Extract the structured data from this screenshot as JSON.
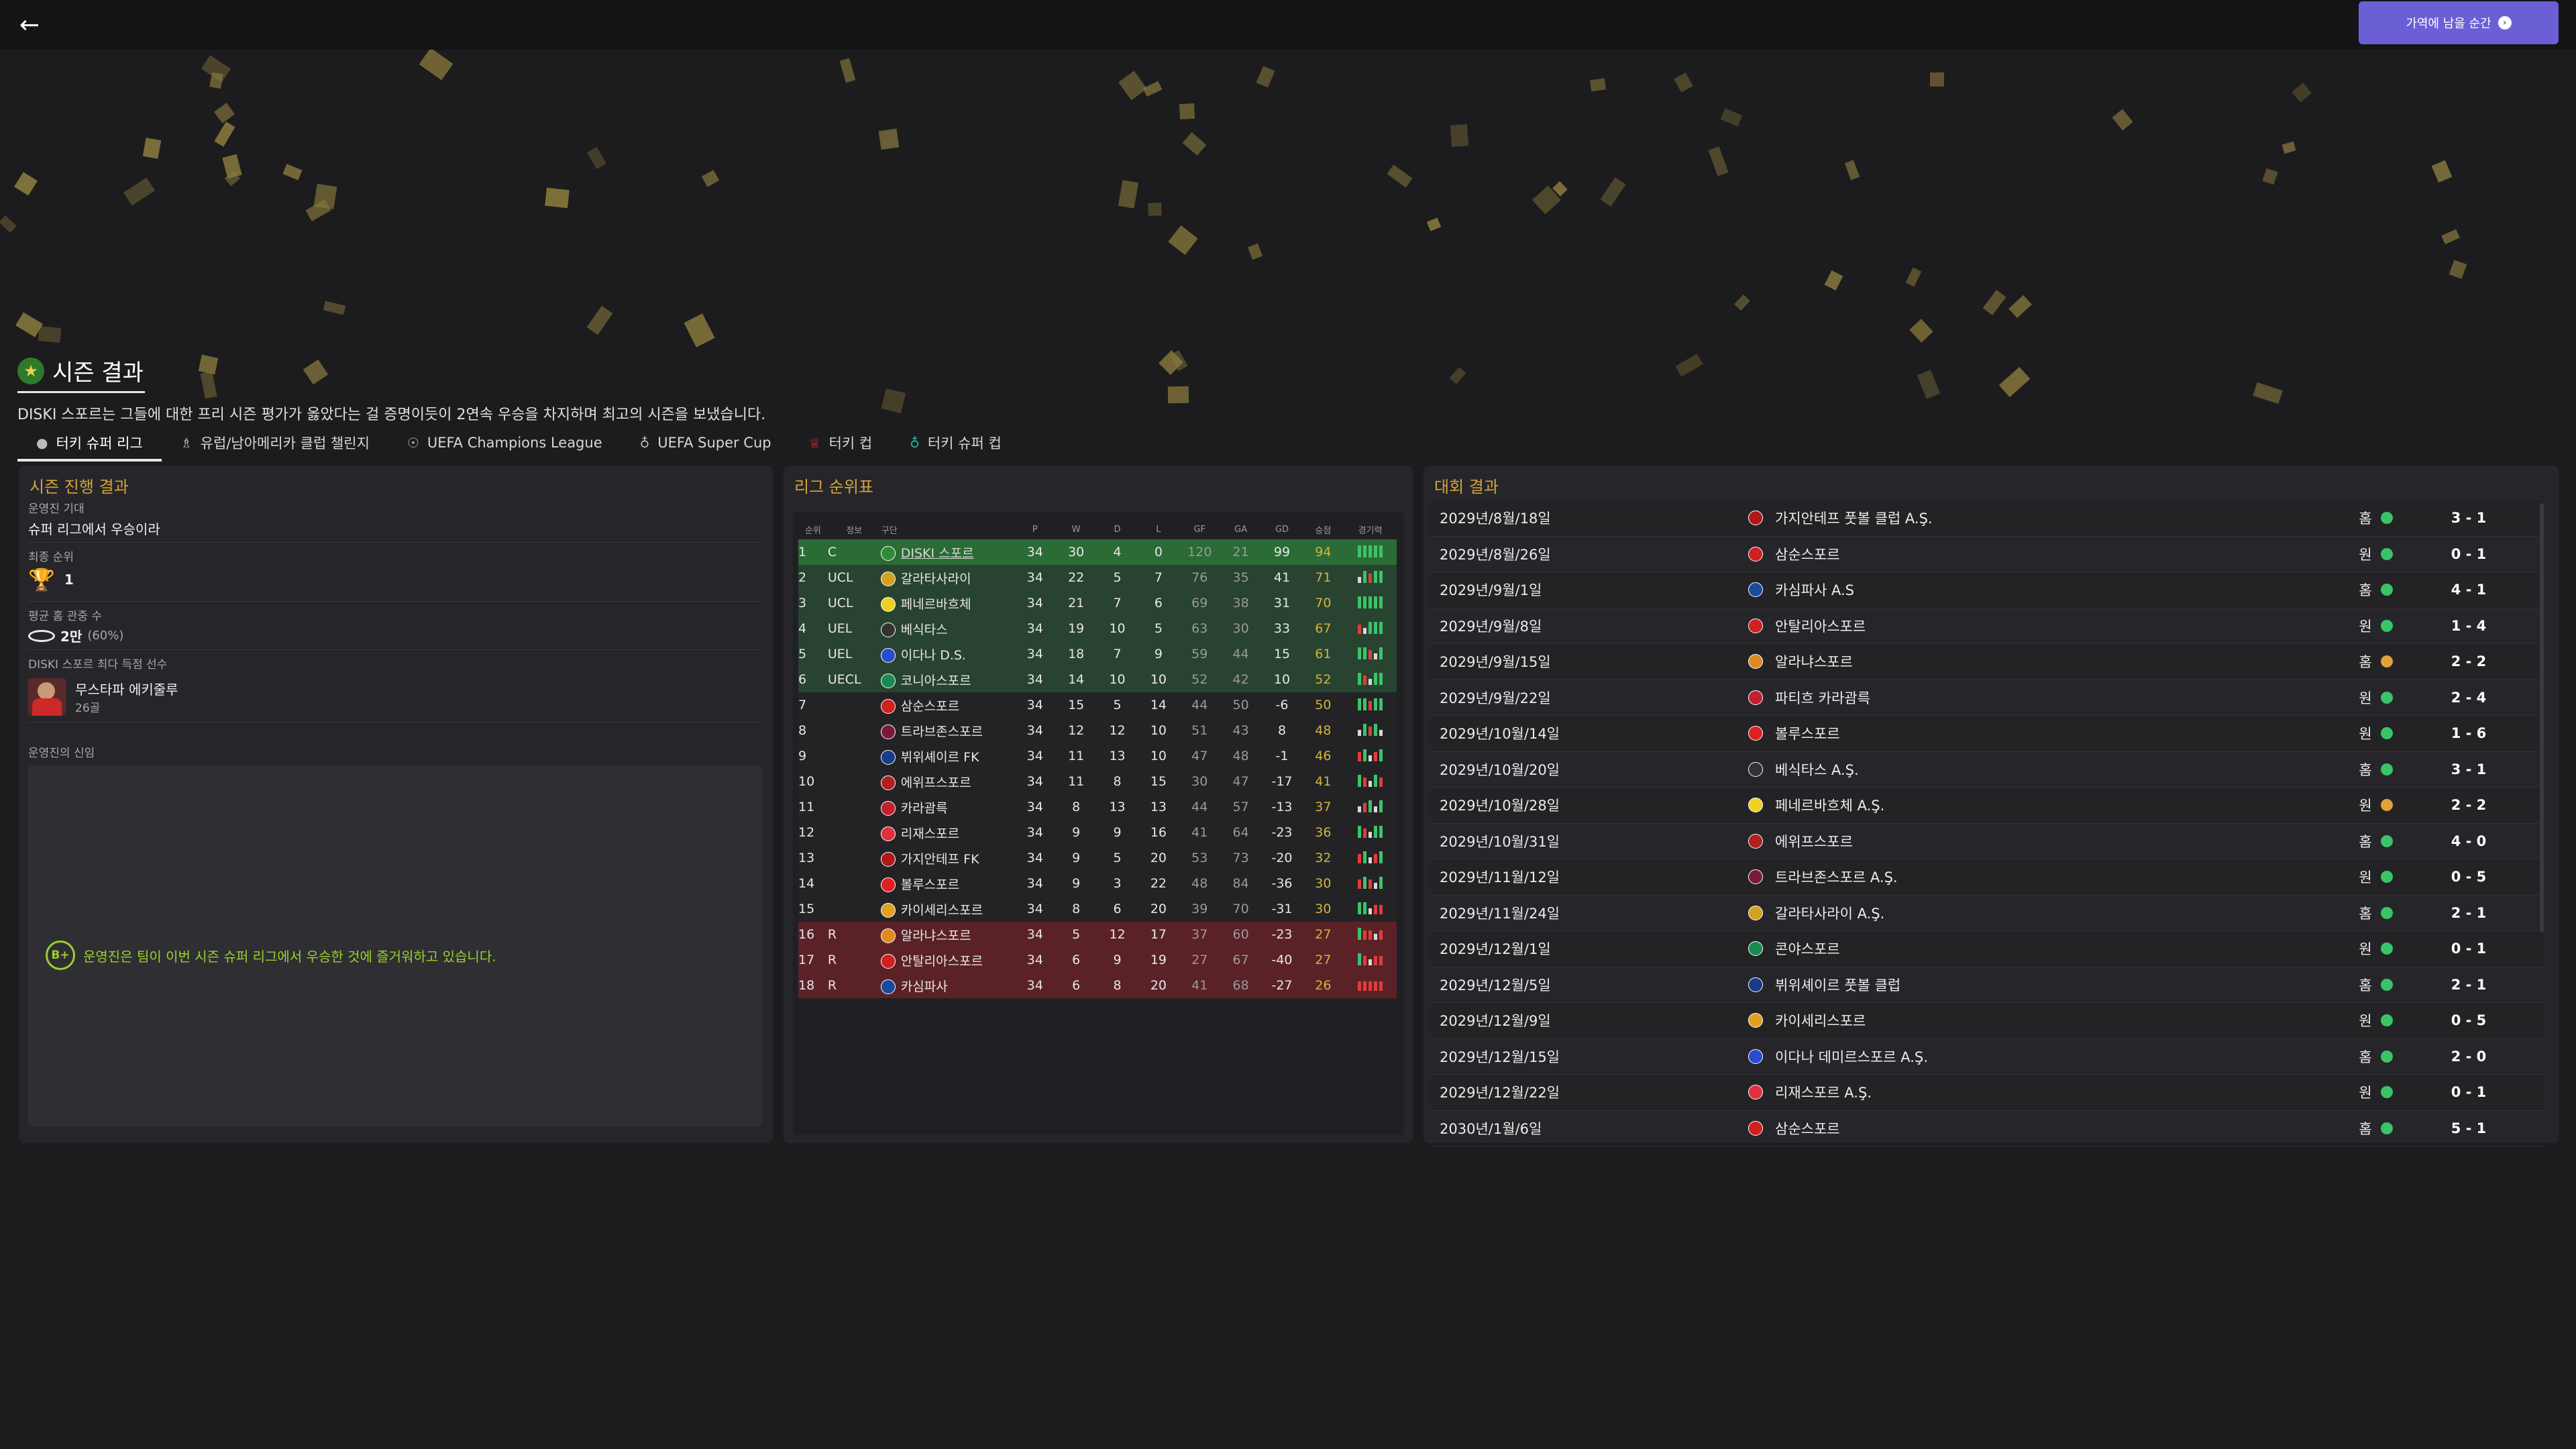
{
  "topbar": {
    "back_icon": "back-arrow-icon",
    "continue_label": "가역에 남을 순간",
    "continue_icon": "chevron-right-icon",
    "accent": "#6b5fd6"
  },
  "header": {
    "title": "시즌 결과",
    "summary": "DISKI 스포르는 그들에 대한 프리 시즌 평가가 옳았다는 걸 증명이듯이 2연속 우승을 차지하며 최고의 시즌을 보냈습니다."
  },
  "tabs": [
    {
      "label": "터키 슈퍼 리그",
      "icon": "league-ball-icon"
    },
    {
      "label": "유럽/남아메리카 클럽 챌린지",
      "icon": "trophy-icon"
    },
    {
      "label": "UEFA Champions League",
      "icon": "champions-league-icon"
    },
    {
      "label": "UEFA Super Cup",
      "icon": "super-cup-icon"
    },
    {
      "label": "터키 컵",
      "icon": "turkish-cup-icon"
    },
    {
      "label": "터키 슈퍼 컵",
      "icon": "super-cup-icon"
    }
  ],
  "season": {
    "title": "시즌 진행 결과",
    "expectation_label": "운영진 기대",
    "expectation_value": "슈퍼 리그에서 우승이라",
    "final_pos_label": "최종 순위",
    "final_pos_value": "1",
    "attendance_label": "평균 홈 관중 수",
    "attendance_value": "2만",
    "attendance_pct": "(60%)",
    "top_scorer_label": "DISKI 스포르 최다 득점 선수",
    "top_scorer_name": "무스타파 에키줄루",
    "top_scorer_goals": "26골",
    "board_label": "운영진의 신임",
    "grade": "B+",
    "board_comment": "운영진은 팀이 이번 시즌 슈퍼 리그에서 우승한 것에 즐거워하고 있습니다."
  },
  "standings": {
    "title": "리그 순위표",
    "headers": [
      "순위",
      "정보",
      "구단",
      "P",
      "W",
      "D",
      "L",
      "GF",
      "GA",
      "GD",
      "승점",
      "경기력"
    ],
    "rows": [
      {
        "pos": "1",
        "info": "C",
        "team": "DISKI 스포르",
        "p": "34",
        "w": "30",
        "d": "4",
        "l": "0",
        "gf": "120",
        "ga": "21",
        "gd": "99",
        "pts": "94",
        "zone": "champ",
        "color": "#2e8b3a",
        "form": "WWWWW"
      },
      {
        "pos": "2",
        "info": "UCL",
        "team": "갈라타사라이",
        "p": "34",
        "w": "22",
        "d": "5",
        "l": "7",
        "gf": "76",
        "ga": "35",
        "gd": "41",
        "pts": "71",
        "zone": "euro",
        "color": "#d4a020",
        "form": "DWLWW"
      },
      {
        "pos": "3",
        "info": "UCL",
        "team": "페네르바흐체",
        "p": "34",
        "w": "21",
        "d": "7",
        "l": "6",
        "gf": "69",
        "ga": "38",
        "gd": "31",
        "pts": "70",
        "zone": "euro",
        "color": "#f0d020",
        "form": "WWWWW"
      },
      {
        "pos": "4",
        "info": "UEL",
        "team": "베식타스",
        "p": "34",
        "w": "19",
        "d": "10",
        "l": "5",
        "gf": "63",
        "ga": "30",
        "gd": "33",
        "pts": "67",
        "zone": "euro",
        "color": "#333333",
        "form": "LDWWW"
      },
      {
        "pos": "5",
        "info": "UEL",
        "team": "이다나 D.S.",
        "p": "34",
        "w": "18",
        "d": "7",
        "l": "9",
        "gf": "59",
        "ga": "44",
        "gd": "15",
        "pts": "61",
        "zone": "euro",
        "color": "#2a4ad0",
        "form": "WWLDW"
      },
      {
        "pos": "6",
        "info": "UECL",
        "team": "코니아스포르",
        "p": "34",
        "w": "14",
        "d": "10",
        "l": "10",
        "gf": "52",
        "ga": "42",
        "gd": "10",
        "pts": "52",
        "zone": "euro",
        "color": "#1a8a50",
        "form": "WLDWW"
      },
      {
        "pos": "7",
        "info": "",
        "team": "삼순스포르",
        "p": "34",
        "w": "15",
        "d": "5",
        "l": "14",
        "gf": "44",
        "ga": "50",
        "gd": "-6",
        "pts": "50",
        "zone": "mid",
        "color": "#d02020",
        "form": "WWLWW"
      },
      {
        "pos": "8",
        "info": "",
        "team": "트라브존스포르",
        "p": "34",
        "w": "12",
        "d": "12",
        "l": "10",
        "gf": "51",
        "ga": "43",
        "gd": "8",
        "pts": "48",
        "zone": "mid",
        "color": "#7a1a3a",
        "form": "DWLWD"
      },
      {
        "pos": "9",
        "info": "",
        "team": "뷔위셰이르 FK",
        "p": "34",
        "w": "11",
        "d": "13",
        "l": "10",
        "gf": "47",
        "ga": "48",
        "gd": "-1",
        "pts": "46",
        "zone": "mid",
        "color": "#1a3a8a",
        "form": "LWDLW"
      },
      {
        "pos": "10",
        "info": "",
        "team": "에위프스포르",
        "p": "34",
        "w": "11",
        "d": "8",
        "l": "15",
        "gf": "30",
        "ga": "47",
        "gd": "-17",
        "pts": "41",
        "zone": "mid",
        "color": "#b02020",
        "form": "WLDWL"
      },
      {
        "pos": "11",
        "info": "",
        "team": "카라괌륵",
        "p": "34",
        "w": "8",
        "d": "13",
        "l": "13",
        "gf": "44",
        "ga": "57",
        "gd": "-13",
        "pts": "37",
        "zone": "mid",
        "color": "#c02030",
        "form": "DLWDW"
      },
      {
        "pos": "12",
        "info": "",
        "team": "리재스포르",
        "p": "34",
        "w": "9",
        "d": "9",
        "l": "16",
        "gf": "41",
        "ga": "64",
        "gd": "-23",
        "pts": "36",
        "zone": "mid",
        "color": "#e03040",
        "form": "WLDWW"
      },
      {
        "pos": "13",
        "info": "",
        "team": "가지안테프 FK",
        "p": "34",
        "w": "9",
        "d": "5",
        "l": "20",
        "gf": "53",
        "ga": "73",
        "gd": "-20",
        "pts": "32",
        "zone": "mid",
        "color": "#b01818",
        "form": "LWDLW"
      },
      {
        "pos": "14",
        "info": "",
        "team": "볼루스포르",
        "p": "34",
        "w": "9",
        "d": "3",
        "l": "22",
        "gf": "48",
        "ga": "84",
        "gd": "-36",
        "pts": "30",
        "zone": "mid",
        "color": "#e02020",
        "form": "LWLDW"
      },
      {
        "pos": "15",
        "info": "",
        "team": "카이세리스포르",
        "p": "34",
        "w": "8",
        "d": "6",
        "l": "20",
        "gf": "39",
        "ga": "70",
        "gd": "-31",
        "pts": "30",
        "zone": "mid",
        "color": "#e0a020",
        "form": "WWDLL"
      },
      {
        "pos": "16",
        "info": "R",
        "team": "알라냐스포르",
        "p": "34",
        "w": "5",
        "d": "12",
        "l": "17",
        "gf": "37",
        "ga": "60",
        "gd": "-23",
        "pts": "27",
        "zone": "rel",
        "color": "#e08a20",
        "form": "WLLDL"
      },
      {
        "pos": "17",
        "info": "R",
        "team": "안탈리아스포르",
        "p": "34",
        "w": "6",
        "d": "9",
        "l": "19",
        "gf": "27",
        "ga": "67",
        "gd": "-40",
        "pts": "27",
        "zone": "rel",
        "color": "#d02020",
        "form": "WLDLL"
      },
      {
        "pos": "18",
        "info": "R",
        "team": "카심파사",
        "p": "34",
        "w": "6",
        "d": "8",
        "l": "20",
        "gf": "41",
        "ga": "68",
        "gd": "-27",
        "pts": "26",
        "zone": "rel",
        "color": "#1a4aa0",
        "form": "LLLLL"
      }
    ]
  },
  "results": {
    "title": "대회 결과",
    "rows": [
      {
        "date": "2029년/8월/18일",
        "team": "가지안테프 풋볼 클럽 A.Ş.",
        "ha": "홈",
        "outcome": "win",
        "score": "3 - 1",
        "color": "#b01818"
      },
      {
        "date": "2029년/8월/26일",
        "team": "삼순스포르",
        "ha": "원",
        "outcome": "win",
        "score": "0 - 1",
        "color": "#d02020"
      },
      {
        "date": "2029년/9월/1일",
        "team": "카심파사 A.S",
        "ha": "홈",
        "outcome": "win",
        "score": "4 - 1",
        "color": "#1a4aa0"
      },
      {
        "date": "2029년/9월/8일",
        "team": "안탈리아스포르",
        "ha": "원",
        "outcome": "win",
        "score": "1 - 4",
        "color": "#d02020"
      },
      {
        "date": "2029년/9월/15일",
        "team": "알라냐스포르",
        "ha": "홈",
        "outcome": "draw",
        "score": "2 - 2",
        "color": "#e08a20"
      },
      {
        "date": "2029년/9월/22일",
        "team": "파티흐 카라괌륵",
        "ha": "원",
        "outcome": "win",
        "score": "2 - 4",
        "color": "#c02030"
      },
      {
        "date": "2029년/10월/14일",
        "team": "볼루스포르",
        "ha": "원",
        "outcome": "win",
        "score": "1 - 6",
        "color": "#e02020"
      },
      {
        "date": "2029년/10월/20일",
        "team": "베식타스 A.Ş.",
        "ha": "홈",
        "outcome": "win",
        "score": "3 - 1",
        "color": "#333333"
      },
      {
        "date": "2029년/10월/28일",
        "team": "페네르바흐체 A.Ş.",
        "ha": "원",
        "outcome": "draw",
        "score": "2 - 2",
        "color": "#f0d020"
      },
      {
        "date": "2029년/10월/31일",
        "team": "에위프스포르",
        "ha": "홈",
        "outcome": "win",
        "score": "4 - 0",
        "color": "#b02020"
      },
      {
        "date": "2029년/11월/12일",
        "team": "트라브존스포르 A.Ş.",
        "ha": "원",
        "outcome": "win",
        "score": "0 - 5",
        "color": "#7a1a3a"
      },
      {
        "date": "2029년/11월/24일",
        "team": "갈라타사라이 A.Ş.",
        "ha": "홈",
        "outcome": "win",
        "score": "2 - 1",
        "color": "#d4a020"
      },
      {
        "date": "2029년/12월/1일",
        "team": "콘야스포르",
        "ha": "원",
        "outcome": "win",
        "score": "0 - 1",
        "color": "#1a8a50"
      },
      {
        "date": "2029년/12월/5일",
        "team": "뷔위셰이르 풋볼 클럽",
        "ha": "홈",
        "outcome": "win",
        "score": "2 - 1",
        "color": "#1a3a8a"
      },
      {
        "date": "2029년/12월/9일",
        "team": "카이세리스포르",
        "ha": "원",
        "outcome": "win",
        "score": "0 - 5",
        "color": "#e0a020"
      },
      {
        "date": "2029년/12월/15일",
        "team": "이다나 데미르스포르 A.Ş.",
        "ha": "홈",
        "outcome": "win",
        "score": "2 - 0",
        "color": "#2a4ad0"
      },
      {
        "date": "2029년/12월/22일",
        "team": "리재스포르 A.Ş.",
        "ha": "원",
        "outcome": "win",
        "score": "0 - 1",
        "color": "#e03040"
      },
      {
        "date": "2030년/1월/6일",
        "team": "삼순스포르",
        "ha": "홈",
        "outcome": "win",
        "score": "5 - 1",
        "color": "#d02020"
      }
    ]
  }
}
